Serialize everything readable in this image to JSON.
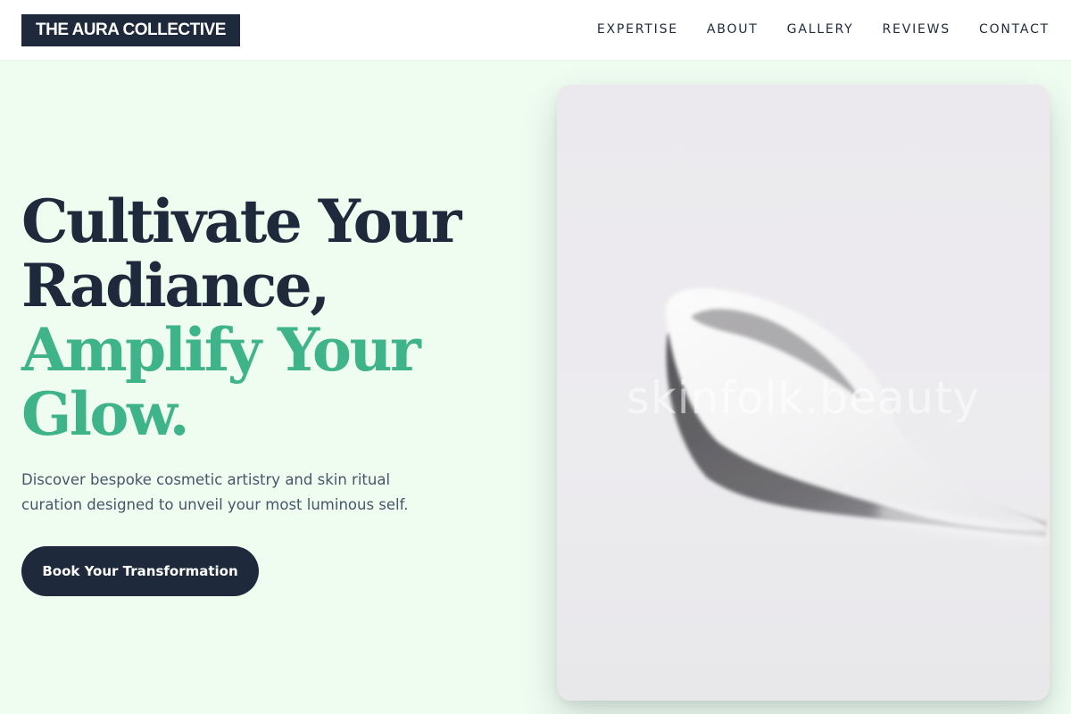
{
  "header": {
    "logo": "THE AURA COLLECTIVE",
    "nav": [
      "EXPERTISE",
      "ABOUT",
      "GALLERY",
      "REVIEWS",
      "CONTACT"
    ]
  },
  "hero": {
    "title_lines": [
      "Cultivate Your",
      "Radiance,"
    ],
    "accent_lines": [
      "Amplify Your",
      "Glow."
    ],
    "subtitle": "Discover bespoke cosmetic artistry and skin ritual curation designed to unveil your most luminous self.",
    "cta_label": "Book Your Transformation"
  },
  "image": {
    "subject": "cream-swatch",
    "watermark": "skinfolk.beauty"
  },
  "colors": {
    "background": "#effdf1",
    "dark": "#1e293b",
    "accent": "#3fb48a",
    "muted_text": "#475569"
  }
}
